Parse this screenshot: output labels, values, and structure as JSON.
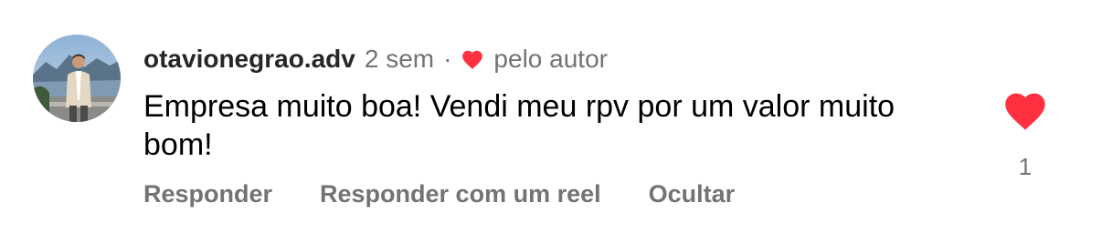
{
  "comment": {
    "username": "otavionegrao.adv",
    "time": "2 sem",
    "separator": "·",
    "author_like_label": "pelo autor",
    "text": "Empresa muito boa! Vendi meu rpv por um valor muito bom!",
    "actions": {
      "reply": "Responder",
      "reply_reel": "Responder com um reel",
      "hide": "Ocultar"
    },
    "like_count": "1",
    "liked": true,
    "liked_by_author": true
  },
  "colors": {
    "heart": "#ff3040",
    "secondary_text": "#737373",
    "primary_text": "#000000"
  },
  "icons": {
    "author_like": "heart-icon",
    "like": "heart-icon",
    "avatar": "profile-photo"
  }
}
